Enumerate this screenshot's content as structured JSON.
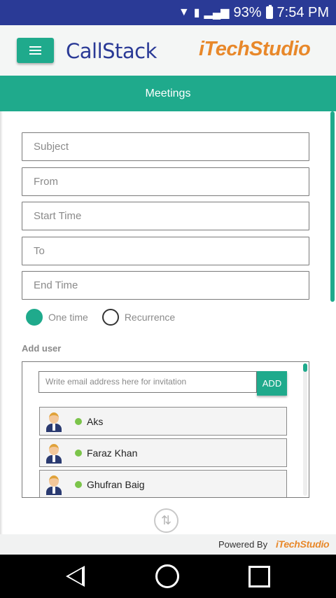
{
  "status_bar": {
    "battery_percent": "93%",
    "time": "7:54 PM"
  },
  "header": {
    "logo_left": "CallStack",
    "logo_right": "iTechStudio"
  },
  "title": "Meetings",
  "form": {
    "subject_placeholder": "Subject",
    "from_placeholder": "From",
    "start_time_placeholder": "Start Time",
    "to_placeholder": "To",
    "end_time_placeholder": "End Time",
    "radio_one_time": "One time",
    "radio_recurrence": "Recurrence",
    "selected_option": "One time",
    "add_user_label": "Add user",
    "email_placeholder": "Write email address here for invitation",
    "add_button": "ADD"
  },
  "users": [
    {
      "name": "Aks",
      "status": "online"
    },
    {
      "name": "Faraz Khan",
      "status": "online"
    },
    {
      "name": "Ghufran Baig",
      "status": "online"
    }
  ],
  "footer": {
    "powered_by": "Powered By",
    "logo": "iTechStudio"
  },
  "colors": {
    "accent": "#1faa8c",
    "status_bar": "#2a3a96",
    "logo_orange": "#e8882a",
    "online": "#7bc44a"
  }
}
